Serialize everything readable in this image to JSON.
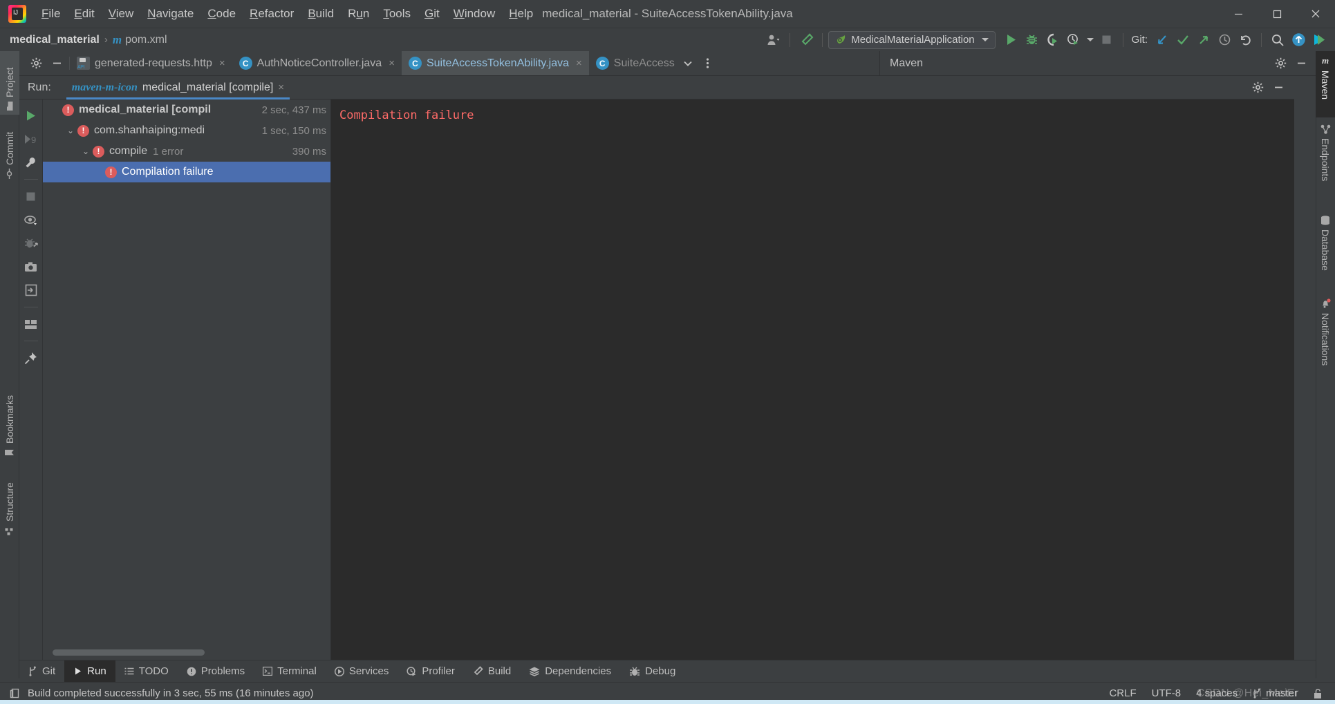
{
  "window": {
    "title": "medical_material - SuiteAccessTokenAbility.java",
    "minimize": "—",
    "maximize": "❐",
    "close": "✕"
  },
  "menubar": {
    "items": [
      {
        "label": "File",
        "mnemonic": "F"
      },
      {
        "label": "Edit",
        "mnemonic": "E"
      },
      {
        "label": "View",
        "mnemonic": "V"
      },
      {
        "label": "Navigate",
        "mnemonic": "N"
      },
      {
        "label": "Code",
        "mnemonic": "C"
      },
      {
        "label": "Refactor",
        "mnemonic": "R"
      },
      {
        "label": "Build",
        "mnemonic": "B"
      },
      {
        "label": "Run",
        "mnemonic": "u"
      },
      {
        "label": "Tools",
        "mnemonic": "T"
      },
      {
        "label": "Git",
        "mnemonic": "G"
      },
      {
        "label": "Window",
        "mnemonic": "W"
      },
      {
        "label": "Help",
        "mnemonic": "H"
      }
    ]
  },
  "navbar": {
    "breadcrumb": {
      "project": "medical_material",
      "separator": "›",
      "module_icon": "m",
      "file": "pom.xml"
    },
    "run_configuration": {
      "name": "MedicalMaterialApplication",
      "icon": "spring-leaf-icon"
    },
    "git_label": "Git:",
    "buttons": [
      "profile-icon",
      "hammer-build-icon",
      "run-icon",
      "debug-icon",
      "run-coverage-icon",
      "run-profiler-icon",
      "stop-icon",
      "git-update-icon",
      "git-commit-icon",
      "git-push-icon",
      "git-history-icon",
      "git-rollback-icon",
      "search-everywhere-icon",
      "updates-icon",
      "ide-assistant-icon"
    ]
  },
  "left_tool_strip": {
    "items": [
      {
        "label": "Project",
        "icon": "folder-icon",
        "active": true
      },
      {
        "label": "Commit",
        "icon": "commit-icon",
        "active": false
      },
      {
        "label": "Bookmarks",
        "icon": "bookmark-icon",
        "active": false
      },
      {
        "label": "Structure",
        "icon": "structure-icon",
        "active": false
      }
    ]
  },
  "right_tool_strip": {
    "items": [
      {
        "label": "Maven",
        "icon": "maven-m-icon",
        "active": true
      },
      {
        "label": "Endpoints",
        "icon": "endpoints-icon",
        "active": false
      },
      {
        "label": "Database",
        "icon": "database-icon",
        "active": false
      },
      {
        "label": "Notifications",
        "icon": "bell-icon",
        "active": false,
        "badge": true
      }
    ]
  },
  "editor_tabs": {
    "settings_icon": "gear-icon",
    "hide_icon": "minimize-icon",
    "tabs": [
      {
        "label": "generated-requests.http",
        "icon": "http-file-icon",
        "active": false,
        "close": "×"
      },
      {
        "label": "AuthNoticeController.java",
        "icon": "java-class-icon",
        "active": false,
        "close": "×"
      },
      {
        "label": "SuiteAccessTokenAbility.java",
        "icon": "java-class-icon",
        "active": true,
        "close": "×"
      },
      {
        "label": "SuiteAccess",
        "icon": "java-class-icon",
        "active": false,
        "close": ""
      }
    ],
    "overflow_icon": "chevron-down-icon",
    "more_icon": "more-vertical-icon"
  },
  "maven_panel": {
    "title": "Maven",
    "settings_icon": "gear-icon",
    "hide_icon": "minimize-icon"
  },
  "run_window": {
    "label": "Run:",
    "tab": {
      "icon": "maven-m-icon",
      "label": "medical_material [compile]",
      "close": "×"
    },
    "settings_icon": "gear-icon",
    "hide_icon": "minimize-icon",
    "gutter_buttons": [
      "rerun-icon",
      "rerun-failed-icon",
      "settings-wrench-icon",
      "stop-icon",
      "toggle-autotest-icon",
      "filter-passed-icon",
      "export-snapshot-icon",
      "import-results-icon",
      "layout-icon",
      "pin-tab-icon"
    ],
    "tree": [
      {
        "label": "medical_material [compil",
        "bold": true,
        "status": "error",
        "time": "2 sec, 437 ms",
        "sub": "",
        "indent": 0,
        "twisty": "",
        "selected": false
      },
      {
        "label": "com.shanhaiping:medi",
        "bold": false,
        "status": "error",
        "time": "1 sec, 150 ms",
        "sub": "",
        "indent": 1,
        "twisty": "⌄",
        "selected": false
      },
      {
        "label": "compile",
        "bold": false,
        "status": "error",
        "time": "390 ms",
        "sub": "1 error",
        "indent": 2,
        "twisty": "⌄",
        "selected": false
      },
      {
        "label": "Compilation failure",
        "bold": false,
        "status": "error",
        "time": "",
        "sub": "",
        "indent": 3,
        "twisty": "",
        "selected": true
      }
    ],
    "console": {
      "lines": [
        "Compilation failure"
      ],
      "text_color": "#ff6b68",
      "background": "#2b2b2b"
    }
  },
  "bottom_bar": {
    "items": [
      {
        "label": "Git",
        "icon": "git-branch-icon",
        "active": false
      },
      {
        "label": "Run",
        "icon": "run-triangle-icon",
        "active": true
      },
      {
        "label": "TODO",
        "icon": "todo-list-icon",
        "active": false
      },
      {
        "label": "Problems",
        "icon": "problems-icon",
        "active": false
      },
      {
        "label": "Terminal",
        "icon": "terminal-icon",
        "active": false
      },
      {
        "label": "Services",
        "icon": "services-icon",
        "active": false
      },
      {
        "label": "Profiler",
        "icon": "profiler-icon",
        "active": false
      },
      {
        "label": "Build",
        "icon": "hammer-icon",
        "active": false
      },
      {
        "label": "Dependencies",
        "icon": "layers-icon",
        "active": false
      },
      {
        "label": "Debug",
        "icon": "bug-icon",
        "active": false
      }
    ]
  },
  "status_bar": {
    "message_icon": "event-log-icon",
    "message": "Build completed successfully in 3 sec, 55 ms (16 minutes ago)",
    "line_separator": "CRLF",
    "encoding": "UTF-8",
    "indent": "4 spaces",
    "branch_icon": "git-branch-icon",
    "branch": "master",
    "lock_icon": "unlocked-icon"
  },
  "watermark": "CSDN @Hei_MeiEr",
  "colors": {
    "background": "#3c3f41",
    "console_bg": "#2b2b2b",
    "accent_blue": "#4a88c7",
    "selection_blue": "#4b6eaf",
    "error_red": "#db5c5c",
    "console_red": "#ff6b68",
    "link_blue": "#3592c4",
    "run_green": "#59a869",
    "text": "#bbbbbb"
  }
}
